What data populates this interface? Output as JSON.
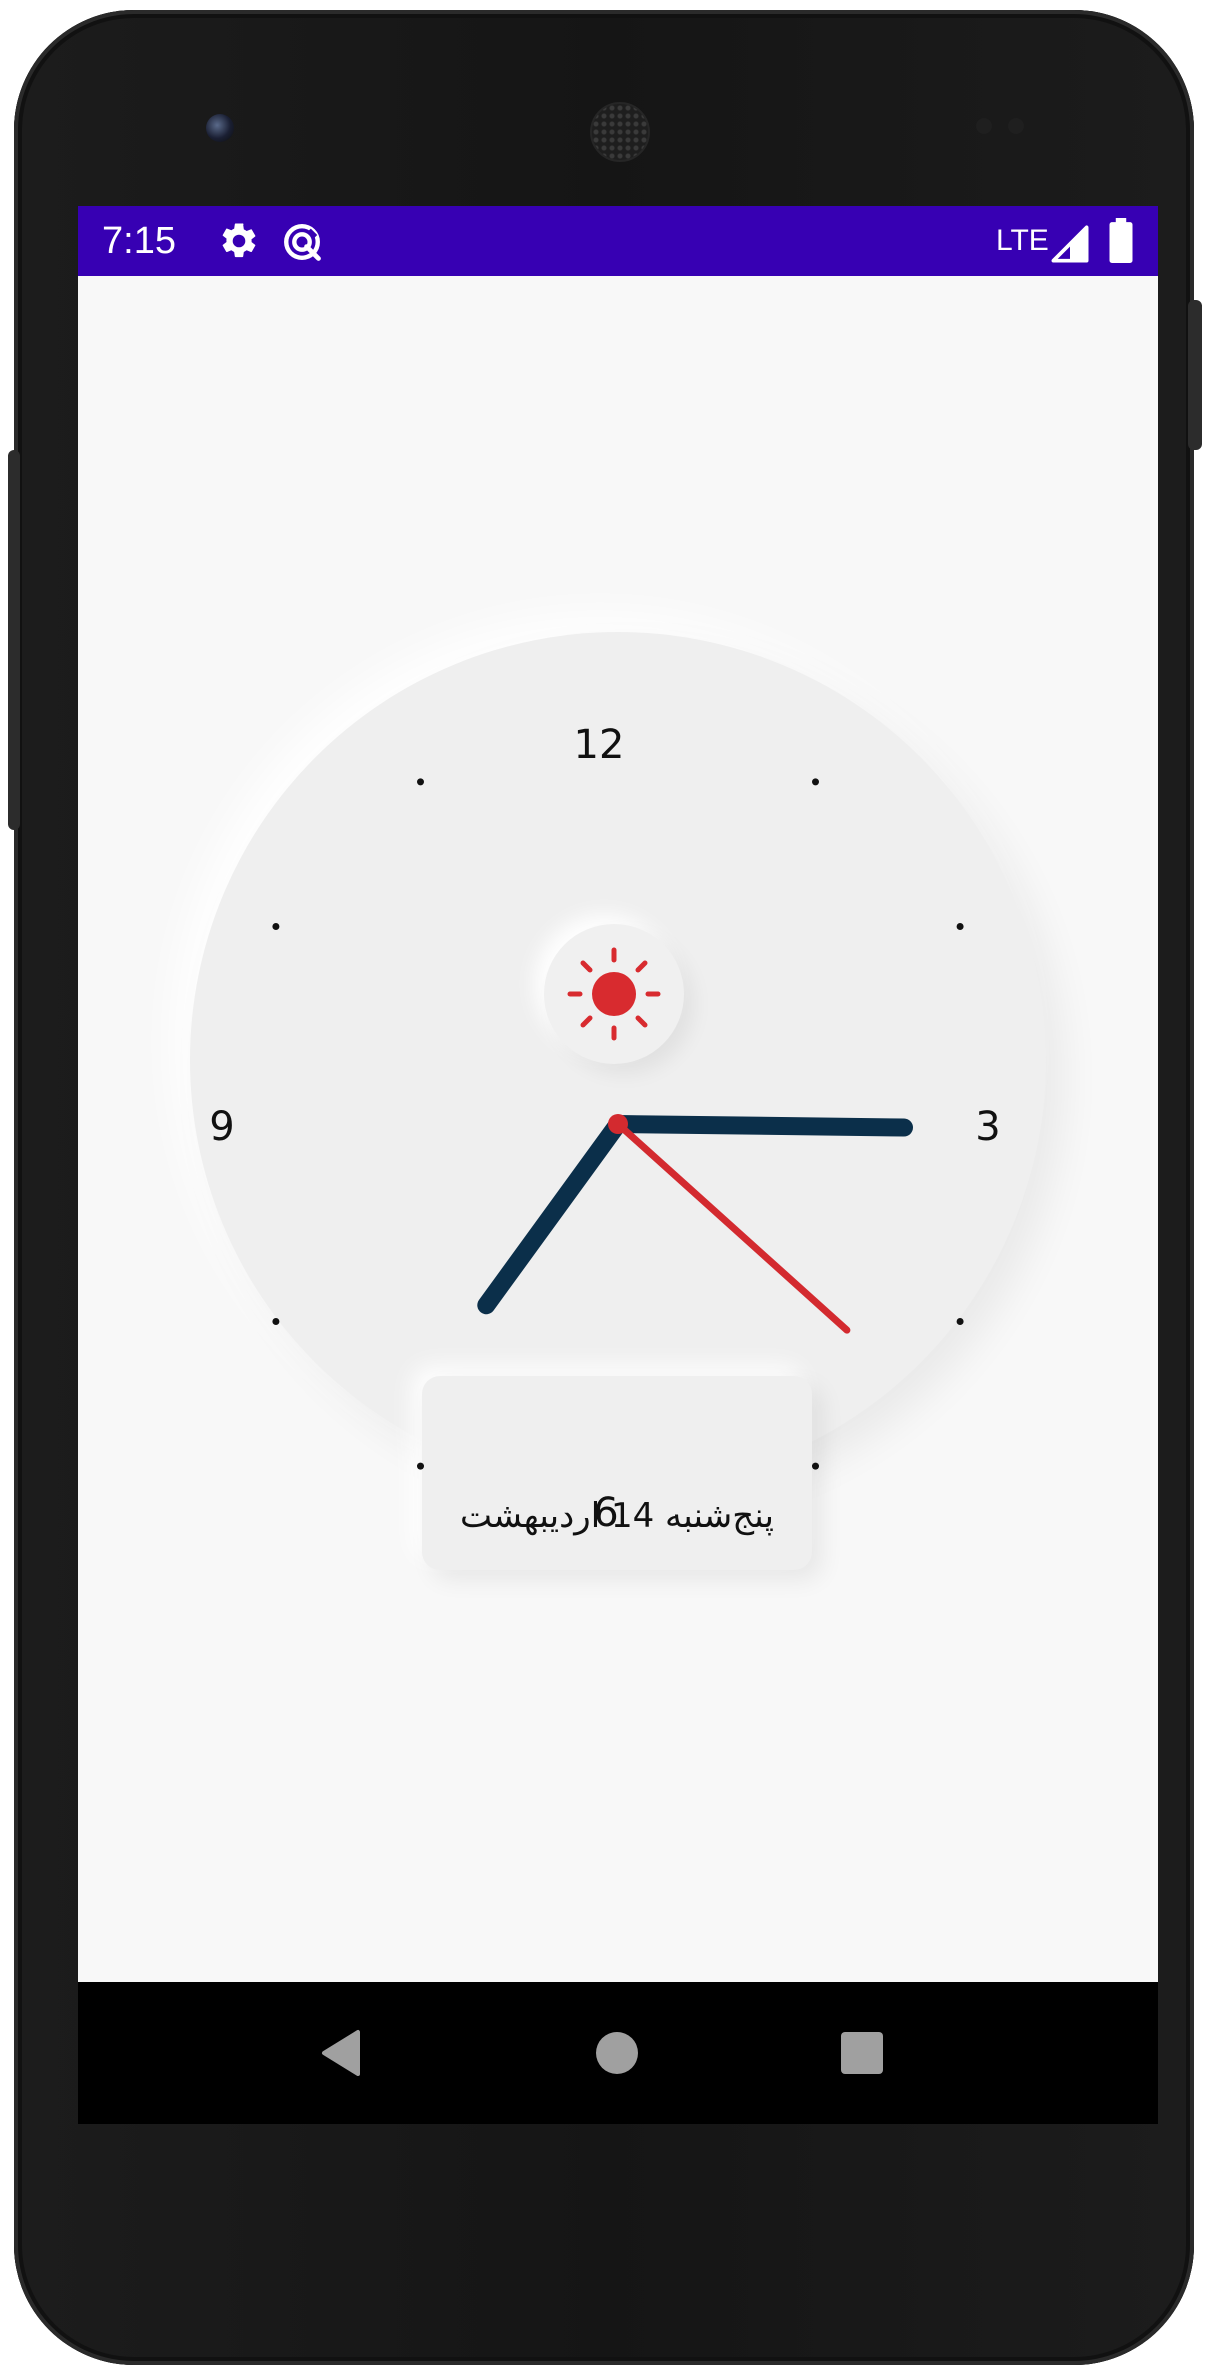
{
  "status_bar": {
    "time": "7:15",
    "network": "LTE",
    "icons": [
      "gear-icon",
      "data-saver-icon",
      "signal-icon",
      "battery-icon"
    ],
    "background": "#3700b3"
  },
  "clock": {
    "numerals": {
      "twelve": "12",
      "three": "3",
      "six": "6",
      "nine": "9"
    },
    "time_shown": {
      "hour": 7,
      "minute": 15,
      "second": 22
    },
    "hand_colors": {
      "hour": "#0b2f4a",
      "minute": "#0b2f4a",
      "second": "#d32a2f"
    },
    "theme_toggle_icon": "sun-icon",
    "sun_color": "#d82b2f",
    "date_text": "پنج‌شنبه 14 اردیبهشت"
  },
  "navigation": {
    "buttons": [
      "back-icon",
      "home-icon",
      "recents-icon"
    ]
  }
}
